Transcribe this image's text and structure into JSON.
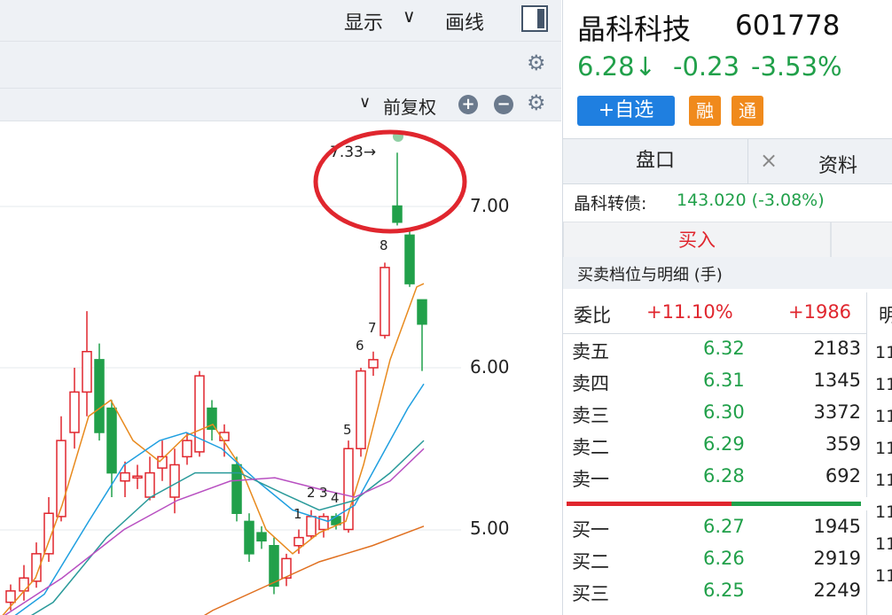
{
  "toolbar": {
    "display_label": "显示",
    "chevron": "chevron-down-icon",
    "draw_label": "画线",
    "adjust_label": "前复权",
    "zoom_in": "plus-circle-icon",
    "zoom_out": "minus-circle-icon",
    "settings": "gear-icon"
  },
  "chart": {
    "high_label": "7.33→",
    "price_ticks": [
      "7.00",
      "6.00",
      "5.00"
    ],
    "day_markers": [
      "1",
      "2",
      "3",
      "4",
      "5",
      "6",
      "7",
      "8"
    ],
    "colors": {
      "up": "#e0262e",
      "down": "#21a04a",
      "ma5": "#e88a1e",
      "ma10": "#1f9fe0",
      "ma20": "#2a9a9a",
      "ma30": "#b84fc1",
      "ma60": "#e07020",
      "highlight": "#e0262e"
    }
  },
  "stock": {
    "name": "晶科科技",
    "code": "601778",
    "price": "6.28↓",
    "change": "-0.23",
    "change_pct": "-3.53%",
    "add_watch": "+自选",
    "margin_badge": "融",
    "connect_badge": "通"
  },
  "tabs": {
    "quote": "盘口",
    "close": "×",
    "info": "资料"
  },
  "bond": {
    "label": "晶科转债:",
    "value": "143.020 (-3.08%)"
  },
  "buy_button": "买入",
  "book_title": "买卖档位与明细 (手)",
  "commission": {
    "label": "委比",
    "ratio": "+11.10%",
    "diff": "+1986",
    "cut_col": "明"
  },
  "asks": [
    {
      "label": "卖五",
      "price": "6.32",
      "volume": "2183"
    },
    {
      "label": "卖四",
      "price": "6.31",
      "volume": "1345"
    },
    {
      "label": "卖三",
      "price": "6.30",
      "volume": "3372"
    },
    {
      "label": "卖二",
      "price": "6.29",
      "volume": "359"
    },
    {
      "label": "卖一",
      "price": "6.28",
      "volume": "692"
    }
  ],
  "bids": [
    {
      "label": "买一",
      "price": "6.27",
      "volume": "1945"
    },
    {
      "label": "买二",
      "price": "6.26",
      "volume": "2919"
    },
    {
      "label": "买三",
      "price": "6.25",
      "volume": "2249"
    }
  ],
  "side_digits": [
    "11",
    "11",
    "11",
    "11",
    "11",
    "11",
    "11",
    "11",
    "11"
  ]
}
